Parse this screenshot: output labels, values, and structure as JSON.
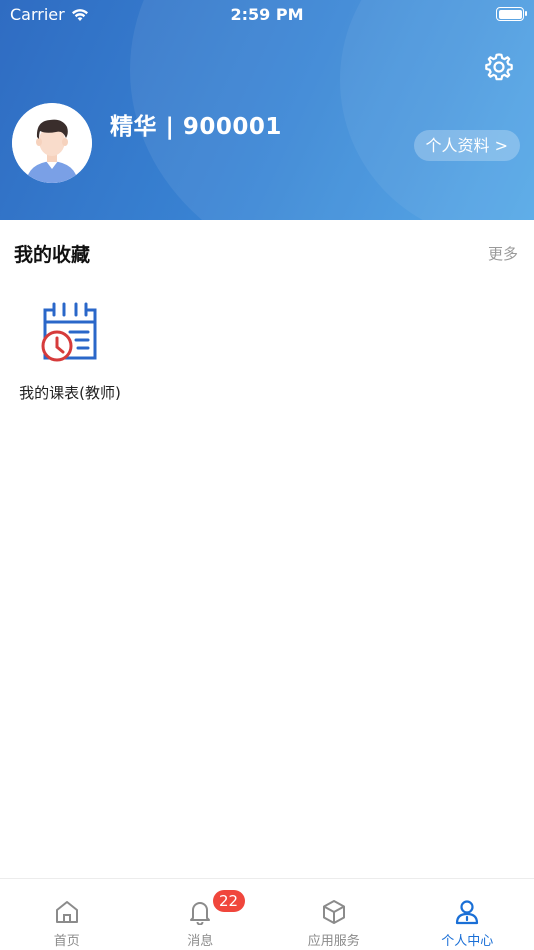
{
  "status_bar": {
    "carrier": "Carrier",
    "time": "2:59 PM"
  },
  "profile": {
    "name_id": "精华 | 900001",
    "profile_button": "个人资料 >"
  },
  "favorites": {
    "title": "我的收藏",
    "more": "更多",
    "items": [
      {
        "label": "我的课表(教师)",
        "icon": "calendar-clock-icon"
      }
    ]
  },
  "tabbar": {
    "tabs": [
      {
        "label": "首页",
        "icon": "home-icon"
      },
      {
        "label": "消息",
        "icon": "bell-icon",
        "badge": "22"
      },
      {
        "label": "应用服务",
        "icon": "cube-icon"
      },
      {
        "label": "个人中心",
        "icon": "person-icon"
      }
    ],
    "active_index": 3
  },
  "colors": {
    "header_gradient_start": "#2f6cc2",
    "header_gradient_end": "#4aa3e6",
    "accent": "#1a6fd6",
    "badge": "#f0463c"
  }
}
